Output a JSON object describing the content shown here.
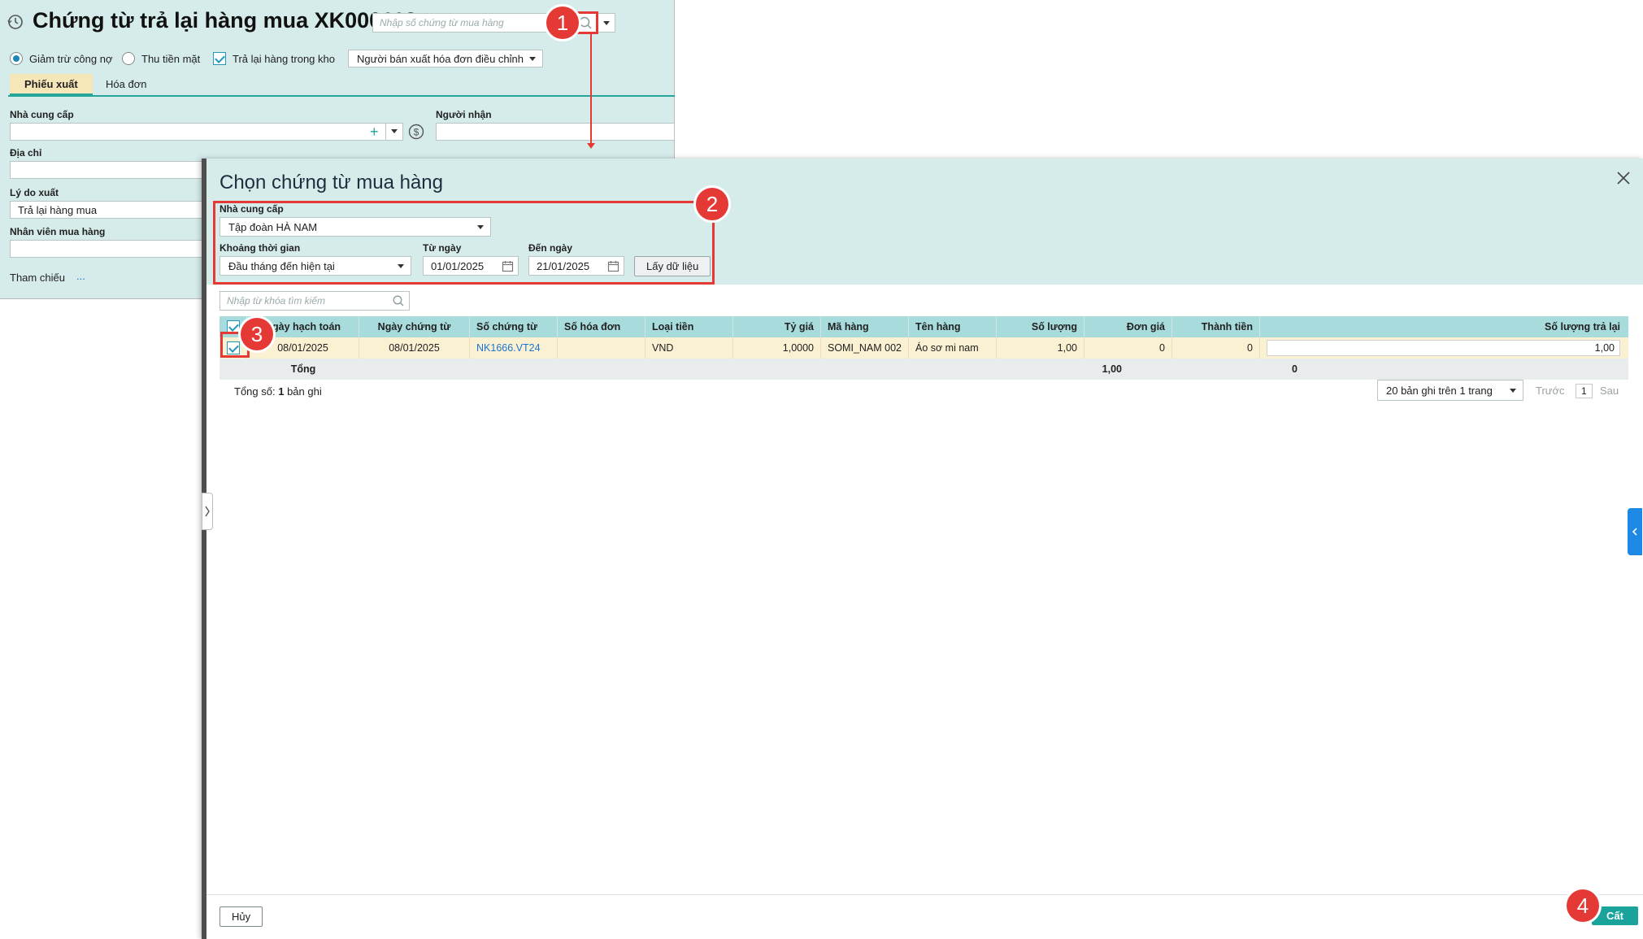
{
  "form": {
    "title": "Chứng từ trả lại hàng mua XK000113",
    "search_placeholder": "Nhập số chứng từ mua hàng",
    "options": {
      "deduct_debt": "Giảm trừ công nợ",
      "cash_refund": "Thu tiền mặt",
      "return_to_stock": "Trả lại hàng trong kho",
      "invoice_mode": "Người bán xuất hóa đơn điều chỉnh"
    },
    "tabs": [
      "Phiếu xuất",
      "Hóa đơn"
    ],
    "fields": {
      "supplier_label": "Nhà cung cấp",
      "receiver_label": "Người nhận",
      "address_label": "Địa chỉ",
      "reason_label": "Lý do xuất",
      "reason_value": "Trả lại hàng mua",
      "buyer_label": "Nhân viên mua hàng",
      "reference_label": "Tham chiếu",
      "reference_value": "..."
    }
  },
  "dialog": {
    "title": "Chọn chứng từ mua hàng",
    "supplier_label": "Nhà cung cấp",
    "supplier_value": "Tập đoàn HÀ NAM",
    "period_label": "Khoảng thời gian",
    "period_value": "Đầu tháng đến hiện tại",
    "from_label": "Từ ngày",
    "from_value": "01/01/2025",
    "to_label": "Đến ngày",
    "to_value": "21/01/2025",
    "load_button": "Lấy dữ liệu",
    "keyword_placeholder": "Nhập từ khóa tìm kiếm",
    "columns": [
      "Ngày hạch toán",
      "Ngày chứng từ",
      "Số chứng từ",
      "Số hóa đơn",
      "Loại tiền",
      "Tỷ giá",
      "Mã hàng",
      "Tên hàng",
      "Số lượng",
      "Đơn giá",
      "Thành tiền",
      "Số lượng trả lại"
    ],
    "rows": [
      {
        "posting_date": "08/01/2025",
        "doc_date": "08/01/2025",
        "doc_no": "NK1666.VT24",
        "invoice_no": "",
        "currency": "VND",
        "rate": "1,0000",
        "item_code": "SOMI_NAM 002",
        "item_name": "Áo sơ mi nam",
        "quantity": "1,00",
        "unit_price": "0",
        "amount": "0",
        "return_qty": "1,00"
      }
    ],
    "total_label": "Tổng",
    "total_quantity": "1,00",
    "total_amount": "0",
    "record_count_prefix": "Tổng số:",
    "record_count": "1",
    "record_count_suffix": "bản ghi",
    "page_size": "20 bản ghi trên 1 trang",
    "prev": "Trước",
    "page": "1",
    "next": "Sau",
    "cancel_button": "Hủy",
    "cut_button": "Cất"
  },
  "annotations": [
    "1",
    "2",
    "3",
    "4"
  ],
  "colors": {
    "header_bg": "#d6eceb",
    "grid_header": "#a8dcdc",
    "row_selected": "#faf0d2",
    "annotation": "#e53935",
    "primary_button": "#1aa39a",
    "link": "#1976d2"
  }
}
